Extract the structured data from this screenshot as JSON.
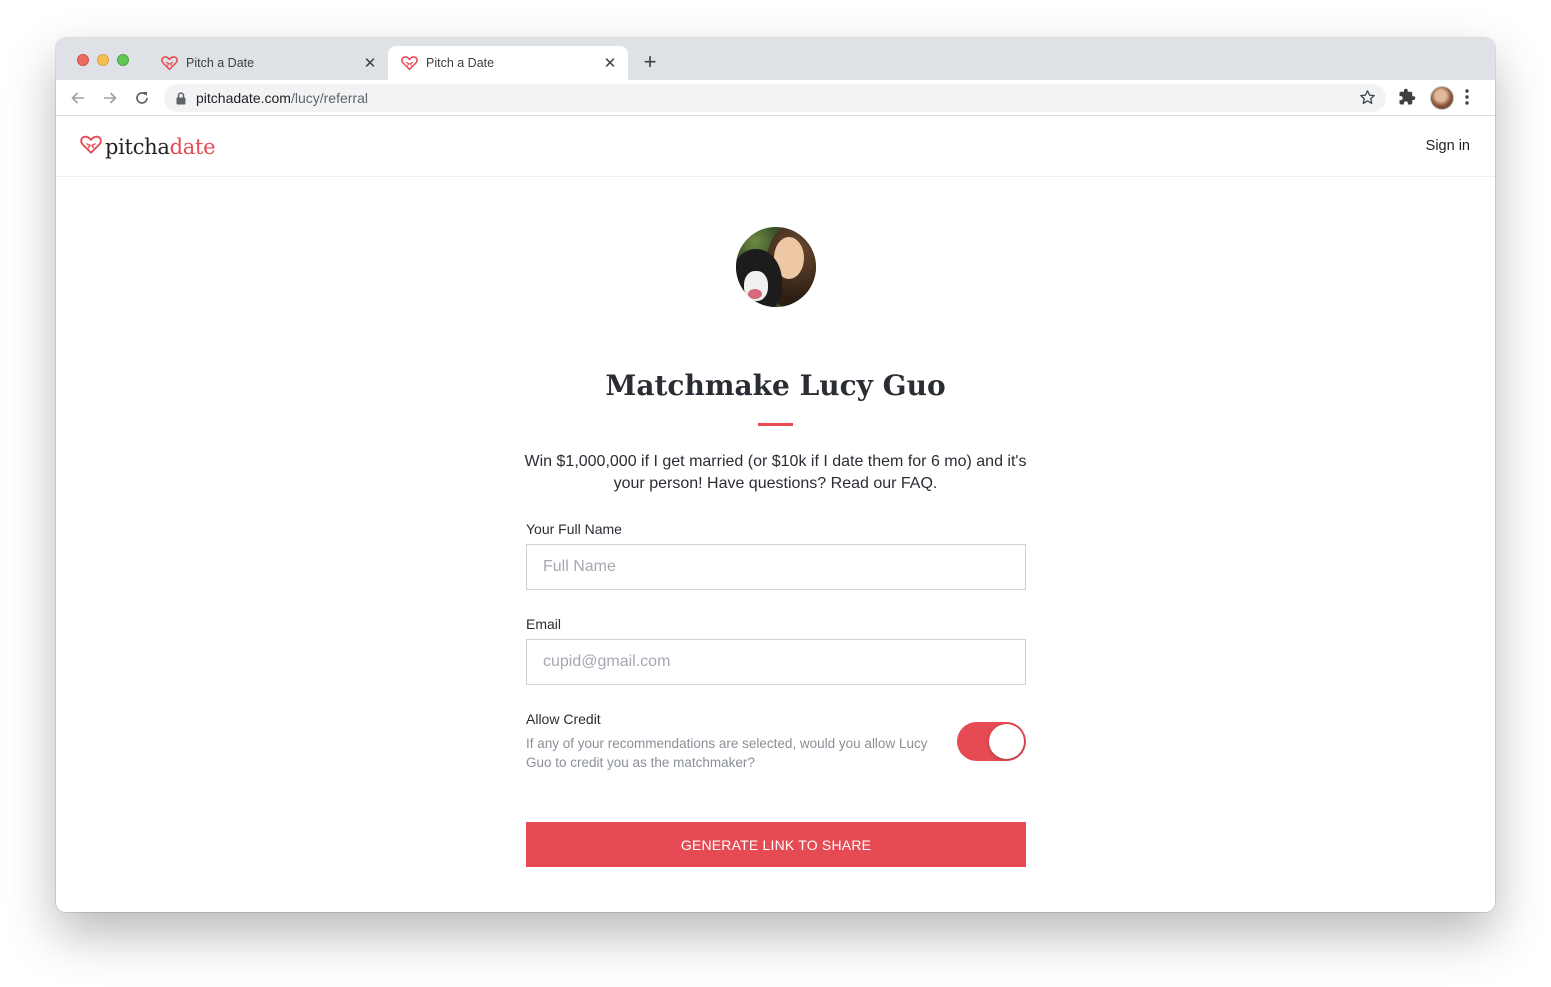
{
  "browser": {
    "tabs": [
      {
        "title": "Pitch a Date",
        "active": false
      },
      {
        "title": "Pitch a Date",
        "active": true
      }
    ],
    "new_tab_label": "+",
    "url_domain": "pitchadate.com",
    "url_path": "/lucy/referral",
    "icons": {
      "back": "back-arrow-icon",
      "forward": "forward-arrow-icon",
      "reload": "reload-icon",
      "lock": "lock-icon",
      "bookmark": "star-icon",
      "extensions": "puzzle-icon",
      "menu": "kebab-menu-icon"
    }
  },
  "site": {
    "logo_part1": "pitcha",
    "logo_part2": "date",
    "sign_in": "Sign in",
    "accent_color": "#e64a53"
  },
  "referral": {
    "title": "Matchmake Lucy Guo",
    "description": "Win $1,000,000 if I get married (or $10k if I date them for 6 mo) and it's your person! Have questions? Read our FAQ.",
    "name_label": "Your Full Name",
    "name_placeholder": "Full Name",
    "name_value": "",
    "email_label": "Email",
    "email_placeholder": "cupid@gmail.com",
    "email_value": "",
    "credit_label": "Allow Credit",
    "credit_description": "If any of your recommendations are selected, would you allow Lucy Guo to credit you as the matchmaker?",
    "credit_enabled": true,
    "submit_label": "GENERATE LINK TO SHARE"
  }
}
